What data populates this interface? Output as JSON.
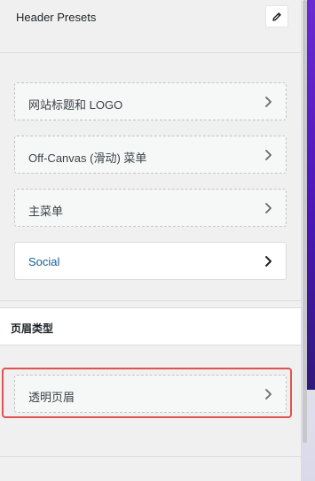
{
  "header": {
    "title": "Header Presets",
    "edit_icon": "pencil-icon"
  },
  "menu": {
    "items": [
      {
        "label": "网站标题和 LOGO",
        "icon": "chevron-right-icon"
      },
      {
        "label": "Off-Canvas (滑动) 菜单",
        "icon": "chevron-right-icon"
      },
      {
        "label": "主菜单",
        "icon": "chevron-right-icon"
      },
      {
        "label": "Social",
        "icon": "chevron-right-icon",
        "state": "active"
      }
    ]
  },
  "section": {
    "title": "页眉类型",
    "items": [
      {
        "label": "透明页眉",
        "icon": "chevron-right-icon",
        "highlighted": true
      }
    ]
  },
  "colors": {
    "highlight_border": "#e0534f",
    "active_label": "#135e96",
    "accent_bar": "#5a22c9"
  }
}
